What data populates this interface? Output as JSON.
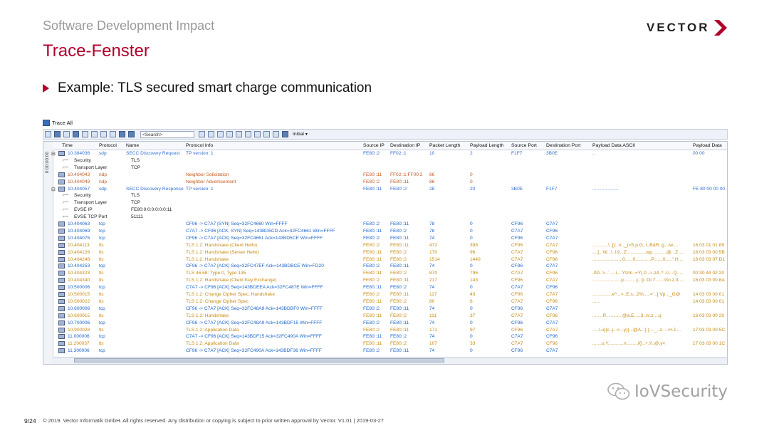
{
  "slide": {
    "subtitle": "Software Development Impact",
    "title": "Trace-Fenster",
    "logo": "VECTOR",
    "bullet": "Example: TLS secured smart charge communication",
    "page": "9/24",
    "copyright": "© 2019. Vector Informatik GmbH. All rights reserved. Any distribution or copying is subject to prior written approval by Vector. V1.01 | 2019-03-27",
    "watermark": "IoVSecurity",
    "accent_color": "#b2002b"
  },
  "trace": {
    "title": "Trace All",
    "search_placeholder": "<Search>",
    "initial_label": "Initial",
    "time_offset": "0:00:00:00",
    "columns": [
      "Time",
      "Protocol",
      "Name",
      "Protocol Info",
      "Source IP",
      "Destination IP",
      "Packet Length",
      "Payload Length",
      "Source Port",
      "Destination Port",
      "Payload Data ASCII",
      "Payload Data"
    ],
    "rows": [
      {
        "type": "msg",
        "expand": "⊟",
        "time": "10.384036",
        "proto": "sdp",
        "name": "SECC Discovery Request",
        "info": "TP version: 1",
        "src": "FE80::2",
        "dst": "FF02::1",
        "plen": "10",
        "paylen": "2",
        "sport": "F1F7",
        "dport": "3B0E",
        "ascii": "..",
        "data": "00 00",
        "cls": "c-sdp"
      },
      {
        "type": "sub",
        "label": "Security",
        "value": "TLS"
      },
      {
        "type": "sub",
        "label": "Transport Layer",
        "value": "TCP"
      },
      {
        "type": "msg",
        "expand": "",
        "time": "10.404043",
        "proto": "ndp",
        "name": "",
        "info": "Neighbor Solicitation",
        "src": "FE80::11",
        "dst": "FF02::1:FF00:2",
        "plen": "86",
        "paylen": "0",
        "sport": "",
        "dport": "",
        "ascii": "",
        "data": "",
        "cls": "c-ndp"
      },
      {
        "type": "msg",
        "expand": "",
        "time": "10.404049",
        "proto": "ndp",
        "name": "",
        "info": "Neighbor Advertisement",
        "src": "FE80::2",
        "dst": "FE80::11",
        "plen": "86",
        "paylen": "0",
        "sport": "",
        "dport": "",
        "ascii": "",
        "data": "",
        "cls": "c-ndp"
      },
      {
        "type": "msg",
        "expand": "⊟",
        "time": "10.404057",
        "proto": "sdp",
        "name": "SECC Discovery Response",
        "info": "TP version: 1",
        "src": "FE80::11",
        "dst": "FE80::2",
        "plen": "28",
        "paylen": "20",
        "sport": "3B0E",
        "dport": "F1F7",
        "ascii": "....................",
        "data": "FE 80 00 00 00",
        "cls": "c-sdp"
      },
      {
        "type": "sub",
        "label": "Security",
        "value": "TLS"
      },
      {
        "type": "sub",
        "label": "Transport Layer",
        "value": "TCP"
      },
      {
        "type": "sub",
        "label": "EVSE IP",
        "value": "FE80:0:0:0:0:0:0:11"
      },
      {
        "type": "sub",
        "label": "EVSE TCP Port",
        "value": "51111"
      },
      {
        "type": "msg",
        "expand": "",
        "time": "10.404063",
        "proto": "tcp",
        "name": "",
        "info": "CF96 -> C7A7 [SYN] Seq=32FC4660 Win=FFFF",
        "src": "FE80::2",
        "dst": "FE80::11",
        "plen": "78",
        "paylen": "0",
        "sport": "CF96",
        "dport": "C7A7",
        "ascii": "",
        "data": "",
        "cls": "c-tcp"
      },
      {
        "type": "msg",
        "expand": "",
        "time": "10.404069",
        "proto": "tcp",
        "name": "",
        "info": "C7A7 -> CF96 [ACK, SYN] Seq=143BD5CD Ack=32FC4661 Win=FFFF",
        "src": "FE80::11",
        "dst": "FE80::2",
        "plen": "78",
        "paylen": "0",
        "sport": "C7A7",
        "dport": "CF96",
        "ascii": "",
        "data": "",
        "cls": "c-tcp"
      },
      {
        "type": "msg",
        "expand": "",
        "time": "10.404075",
        "proto": "tcp",
        "name": "",
        "info": "CF96 -> C7A7 [ACK] Seq=32FC4661 Ack=143BD5CE Win=FFFF",
        "src": "FE80::2",
        "dst": "FE80::11",
        "plen": "74",
        "paylen": "0",
        "sport": "CF96",
        "dport": "C7A7",
        "ascii": "",
        "data": "",
        "cls": "c-tcp"
      },
      {
        "type": "msg",
        "expand": "",
        "time": "10.404113",
        "proto": "tls",
        "name": "",
        "info": "TLS 1.2: Handshake (Client Hello)",
        "src": "FE80::2",
        "dst": "FE80::11",
        "plen": "472",
        "paylen": "398",
        "sport": "CF96",
        "dport": "C7A7",
        "ascii": "............\\..[}:..#.._}>S.p.G..I..B&R..g.../w....",
        "data": "16 03 01 01 89",
        "cls": "c-tls"
      },
      {
        "type": "msg",
        "expand": "",
        "time": "10.404126",
        "proto": "tls",
        "name": "",
        "info": "TLS 1.2: Handshake (Server Hello)",
        "src": "FE80::11",
        "dst": "FE80::2",
        "plen": "170",
        "paylen": "96",
        "sport": "C7A7",
        "dport": "CF96",
        "ascii": "....[...W...\\..l.9...Z...............wp...........@...Z ....",
        "data": "16 03 03 00 5B",
        "cls": "c-tls"
      },
      {
        "type": "msg",
        "expand": "",
        "time": "10.404248",
        "proto": "tls",
        "name": "",
        "info": "TLS 1.2: Handshake",
        "src": "FE80::11",
        "dst": "FE80::2",
        "plen": "1514",
        "paylen": "1440",
        "sport": "C7A7",
        "dport": "CF96",
        "ascii": ".......................0......0............P.......0.....\".H....",
        "data": "16 03 03 07 D1",
        "cls": "c-tls"
      },
      {
        "type": "msg",
        "expand": "",
        "time": "10.404253",
        "proto": "tcp",
        "name": "",
        "info": "CF96 -> C7A7 [ACK] Seq=32FC47EF Ack=143BDBCE Win=FD20",
        "src": "FE80::2",
        "dst": "FE80::11",
        "plen": "74",
        "paylen": "0",
        "sport": "CF96",
        "dport": "C7A7",
        "ascii": "",
        "data": "",
        "cls": "c-tcp"
      },
      {
        "type": "msg",
        "expand": "",
        "time": "10.404323",
        "proto": "tls",
        "name": "",
        "info": "TLS 46.68: Type 0, Type 135",
        "src": "FE80::11",
        "dst": "FE80::2",
        "plen": "870",
        "paylen": "796",
        "sport": "C7A7",
        "dport": "CF96",
        "ascii": ".0D. >..`.....i....YUm..=Y(.0...i..z4..*..U...Q.....",
        "data": "00 30 44 02 20",
        "cls": "c-tls"
      },
      {
        "type": "msg",
        "expand": "",
        "time": "10.404340",
        "proto": "tls",
        "name": "",
        "info": "TLS 1.2: Handshake (Client Key Exchange)",
        "src": "FE80::2",
        "dst": "FE80::11",
        "plen": "217",
        "paylen": "143",
        "sport": "CF96",
        "dport": "C7A7",
        "ascii": "......................p..........j...[i..Gi.7.......Go.z.II.....",
        "data": "16 03 03 00 8A",
        "cls": "c-tls"
      },
      {
        "type": "msg",
        "expand": "",
        "time": "10.500006",
        "proto": "tcp",
        "name": "",
        "info": "C7A7 -> CF96 [ACK] Seq=143BDEEA Ack=32FC487E Win=FFFF",
        "src": "FE80::11",
        "dst": "FE80::2",
        "plen": "74",
        "paylen": "0",
        "sport": "C7A7",
        "dport": "CF96",
        "ascii": "",
        "data": "",
        "cls": "c-tcp"
      },
      {
        "type": "msg",
        "expand": "",
        "time": "10.500015",
        "proto": "tls",
        "name": "",
        "info": "TLS 1.2: Change Cipher Spec, Handshake",
        "src": "FE80::2",
        "dst": "FE80::11",
        "plen": "117",
        "paylen": "43",
        "sport": "CF96",
        "dport": "C7A7",
        "ascii": "...............e^...>..E.s..,2%.....=`..[ Vp..._G@",
        "data": "14 03 03 00 01",
        "cls": "c-tls"
      },
      {
        "type": "msg",
        "expand": "",
        "time": "10.500022",
        "proto": "tls",
        "name": "",
        "info": "TLS 1.2: Change Cipher Spec",
        "src": "FE80::11",
        "dst": "FE80::2",
        "plen": "80",
        "paylen": "6",
        "sport": "C7A7",
        "dport": "CF96",
        "ascii": "......",
        "data": "14 03 03 00 01",
        "cls": "c-tls"
      },
      {
        "type": "msg",
        "expand": "",
        "time": "10.600006",
        "proto": "tcp",
        "name": "",
        "info": "CF96 -> C7A7 [ACK] Seq=32FC48A9 Ack=143BDBF0 Win=FFFF",
        "src": "FE80::2",
        "dst": "FE80::11",
        "plen": "74",
        "paylen": "0",
        "sport": "CF96",
        "dport": "C7A7",
        "ascii": "",
        "data": "",
        "cls": "c-tcp"
      },
      {
        "type": "msg",
        "expand": "",
        "time": "10.600015",
        "proto": "tls",
        "name": "",
        "info": "TLS 1.2: Handshake",
        "src": "FE80::11",
        "dst": "FE80::2",
        "plen": "111",
        "paylen": "37",
        "sport": "C7A7",
        "dport": "CF96",
        "ascii": "..... ..P.. ......... @a.E.....3..n/.z....q",
        "data": "16 03 03 00 20",
        "cls": "c-tls"
      },
      {
        "type": "msg",
        "expand": "",
        "time": "10.700006",
        "proto": "tcp",
        "name": "",
        "info": "CF96 -> C7A7 [ACK] Seq=32FC48A9 Ack=143BDF15 Win=FFFF",
        "src": "FE80::2",
        "dst": "FE80::11",
        "plen": "74",
        "paylen": "0",
        "sport": "CF96",
        "dport": "C7A7",
        "ascii": "",
        "data": "",
        "cls": "c-tcp"
      },
      {
        "type": "msg",
        "expand": "",
        "time": "10.900028",
        "proto": "tls",
        "name": "",
        "info": "TLS 1.2: Application Data",
        "src": "FE80::2",
        "dst": "FE80::11",
        "plen": "171",
        "paylen": "97",
        "sport": "CF96",
        "dport": "C7A7",
        "ascii": ".....\\.u]{c..j...<...y}{...@A...}.}...._..z.....H.J....",
        "data": "17 03 03 00 5C",
        "cls": "c-tls"
      },
      {
        "type": "msg",
        "expand": "",
        "time": "11.000006",
        "proto": "tcp",
        "name": "",
        "info": "C7A7 -> CF96 [ACK] Seq=143BDF15 Ack=32FC490A Win=FFFF",
        "src": "FE80::11",
        "dst": "FE80::2",
        "plen": "74",
        "paylen": "0",
        "sport": "C7A7",
        "dport": "CF96",
        "ascii": "",
        "data": "",
        "cls": "c-tcp"
      },
      {
        "type": "msg",
        "expand": "",
        "time": "11.200037",
        "proto": "tls",
        "name": "",
        "info": "TLS 1.2: Application Data",
        "src": "FE80::11",
        "dst": "FE80::2",
        "plen": "107",
        "paylen": "33",
        "sport": "C7A7",
        "dport": "CF96",
        "ascii": ".......u.Y............n.........f{}..+.Y..@.y<",
        "data": "17 03 03 00 1C",
        "cls": "c-tls"
      },
      {
        "type": "msg",
        "expand": "",
        "time": "11.300006",
        "proto": "tcp",
        "name": "",
        "info": "CF96 -> C7A7 [ACK] Seq=32FC490A Ack=143BDF36 Win=FFFF",
        "src": "FE80::2",
        "dst": "FE80::11",
        "plen": "74",
        "paylen": "0",
        "sport": "CF96",
        "dport": "C7A7",
        "ascii": "",
        "data": "",
        "cls": "c-tcp"
      }
    ]
  }
}
